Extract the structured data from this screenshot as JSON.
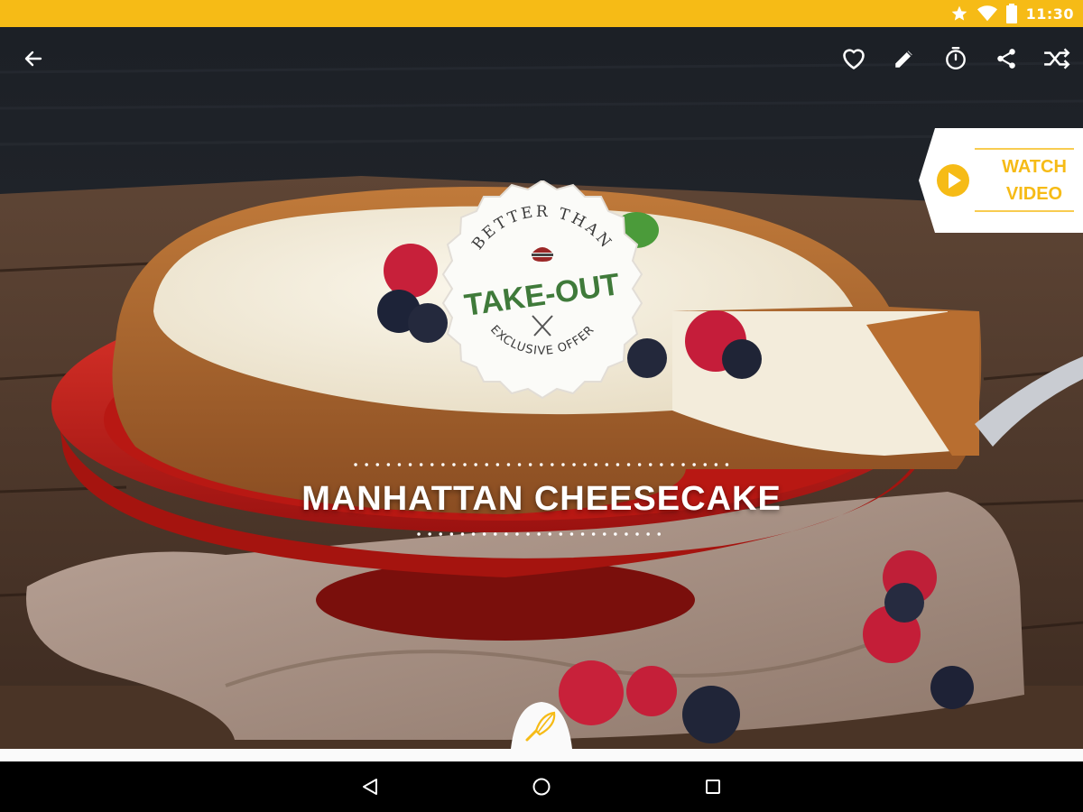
{
  "status_bar": {
    "time": "11:30",
    "icons": [
      "star-icon",
      "wifi-icon",
      "battery-icon"
    ]
  },
  "toolbar": {
    "back_icon": "arrow-left-icon",
    "actions": [
      "heart-icon",
      "pencil-icon",
      "timer-icon",
      "share-icon",
      "shuffle-icon"
    ]
  },
  "watch_video": {
    "line1": "WATCH",
    "line2": "VIDEO",
    "icon": "play-icon"
  },
  "badge": {
    "top_text": "BETTER THAN",
    "main_text": "TAKE-OUT",
    "bottom_text": "EXCLUSIVE OFFER"
  },
  "recipe": {
    "title": "MANHATTAN CHEESECAKE"
  },
  "tab": {
    "icon": "whisk-icon"
  },
  "nav_bar": {
    "buttons": [
      "back-triangle-icon",
      "home-circle-icon",
      "recents-square-icon"
    ]
  },
  "colors": {
    "accent": "#f6bb16",
    "plate": "#c8201c",
    "crust": "#b0672d",
    "cheese": "#f2ecdc"
  }
}
